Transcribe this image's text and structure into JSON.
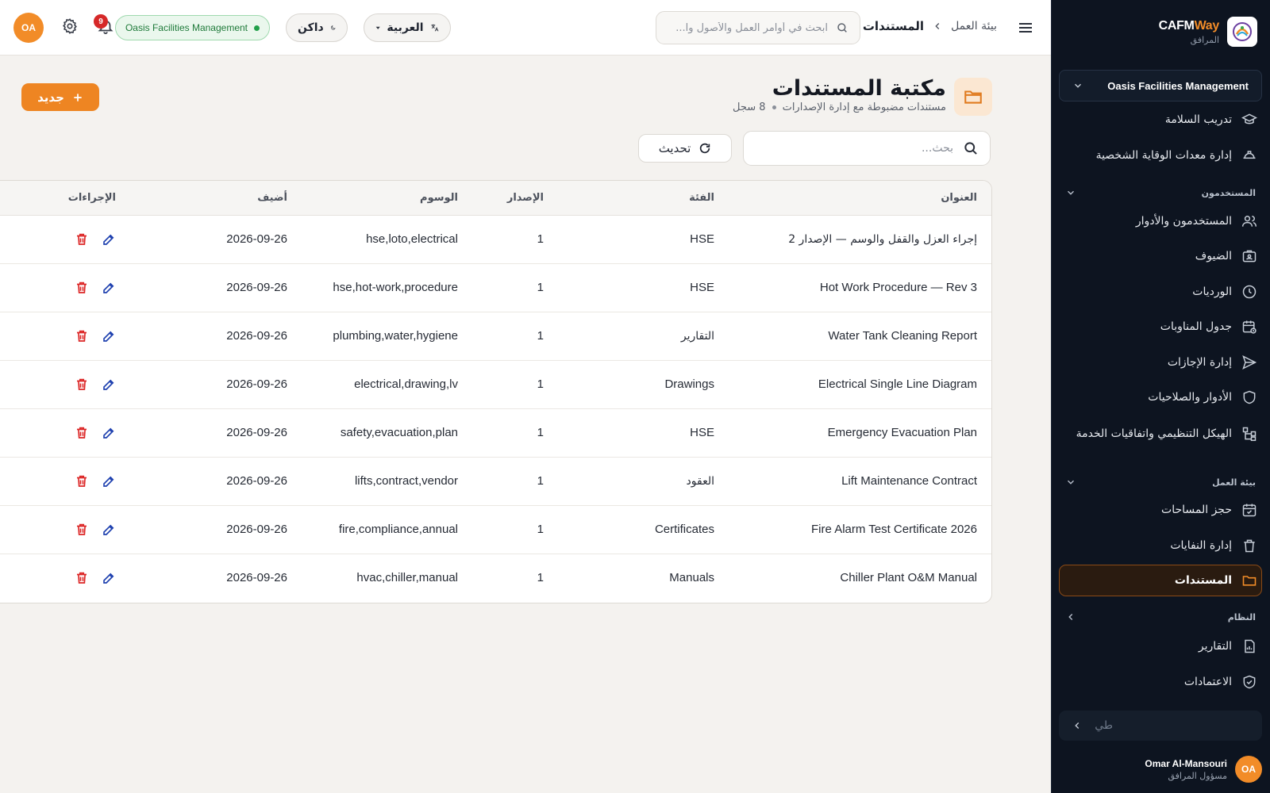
{
  "brand": {
    "name_main": "CAFM",
    "name_accent": "Way",
    "subtitle": "المرافق"
  },
  "sidebar": {
    "org_selector": "Oasis Facilities Management",
    "items": [
      {
        "label": "تدريب السلامة",
        "icon": "graduation-cap-icon"
      },
      {
        "label": "إدارة معدات الوقاية الشخصية",
        "icon": "hard-hat-icon"
      }
    ],
    "sections": [
      {
        "title": "المستخدمون",
        "items": [
          {
            "label": "المستخدمون والأدوار",
            "icon": "users-icon"
          },
          {
            "label": "الضيوف",
            "icon": "guest-badge-icon"
          },
          {
            "label": "الورديات",
            "icon": "clock-icon"
          },
          {
            "label": "جدول المناوبات",
            "icon": "calendar-clock-icon"
          },
          {
            "label": "إدارة الإجازات",
            "icon": "plane-icon"
          },
          {
            "label": "الأدوار والصلاحيات",
            "icon": "shield-icon"
          },
          {
            "label": "الهيكل التنظيمي واتفاقيات الخدمة",
            "icon": "org-chart-icon"
          }
        ]
      },
      {
        "title": "بيئة العمل",
        "items": [
          {
            "label": "حجز المساحات",
            "icon": "calendar-check-icon"
          },
          {
            "label": "إدارة النفايات",
            "icon": "trash-icon"
          },
          {
            "label": "المستندات",
            "icon": "folder-icon",
            "active": true
          }
        ]
      },
      {
        "title": "النظام",
        "items": [
          {
            "label": "التقارير",
            "icon": "report-icon"
          },
          {
            "label": "الاعتمادات",
            "icon": "shield-check-icon"
          }
        ]
      }
    ],
    "search_placeholder": "طي",
    "user": {
      "initials": "OA",
      "name": "Omar Al-Mansouri",
      "role": "مسؤول المرافق"
    }
  },
  "topbar": {
    "breadcrumb": {
      "root": "بيئة العمل",
      "current": "المستندات"
    },
    "search_placeholder": "ابحث في أوامر العمل والأصول وا...",
    "language": "العربية",
    "theme": "داكن",
    "org_badge": "Oasis Facilities Management",
    "notifications_count": "9",
    "user_initials": "OA"
  },
  "page": {
    "title": "مكتبة المستندات",
    "subtitle": "مستندات مضبوطة مع إدارة الإصدارات",
    "record_count": "8 سجل",
    "new_button": "جديد",
    "search_placeholder": "بحث...",
    "refresh_button": "تحديث"
  },
  "table": {
    "columns": [
      "العنوان",
      "الفئة",
      "الإصدار",
      "الوسوم",
      "أضيف",
      "الإجراءات"
    ],
    "rows": [
      {
        "title": "إجراء العزل والقفل والوسم — الإصدار 2",
        "category": "HSE",
        "version": "1",
        "tags": "hse,loto,electrical",
        "added": "2026-09-26"
      },
      {
        "title": "Hot Work Procedure — Rev 3",
        "category": "HSE",
        "version": "1",
        "tags": "hse,hot-work,procedure",
        "added": "2026-09-26"
      },
      {
        "title": "Water Tank Cleaning Report",
        "category": "التقارير",
        "version": "1",
        "tags": "plumbing,water,hygiene",
        "added": "2026-09-26"
      },
      {
        "title": "Electrical Single Line Diagram",
        "category": "Drawings",
        "version": "1",
        "tags": "electrical,drawing,lv",
        "added": "2026-09-26"
      },
      {
        "title": "Emergency Evacuation Plan",
        "category": "HSE",
        "version": "1",
        "tags": "safety,evacuation,plan",
        "added": "2026-09-26"
      },
      {
        "title": "Lift Maintenance Contract",
        "category": "العقود",
        "version": "1",
        "tags": "lifts,contract,vendor",
        "added": "2026-09-26"
      },
      {
        "title": "Fire Alarm Test Certificate 2026",
        "category": "Certificates",
        "version": "1",
        "tags": "fire,compliance,annual",
        "added": "2026-09-26"
      },
      {
        "title": "Chiller Plant O&M Manual",
        "category": "Manuals",
        "version": "1",
        "tags": "hvac,chiller,manual",
        "added": "2026-09-26"
      }
    ]
  },
  "colors": {
    "accent": "#ee8522",
    "sidebar_bg": "#0d1420",
    "danger": "#dc2626",
    "edit": "#1e40af",
    "success": "#22a04a"
  }
}
